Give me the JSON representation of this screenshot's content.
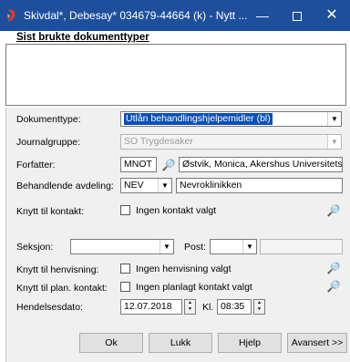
{
  "window": {
    "title": "Skivdal*, Debesay* 034679-44664 (k) - Nytt ...",
    "minimize": "—",
    "close": "✕"
  },
  "recent": {
    "label": "Sist brukte dokumenttyper"
  },
  "form": {
    "dokumenttype": {
      "label": "Dokumenttype:",
      "value": "Utlån behandlingshjelpemidler (bl)"
    },
    "journalgruppe": {
      "label": "Journalgruppe:",
      "value": "SO Trygdesaker"
    },
    "forfatter": {
      "label": "Forfatter:",
      "code": "MNOT",
      "name": "Østvik, Monica, Akershus Universitetssy"
    },
    "avdeling": {
      "label": "Behandlende avdeling:",
      "code": "NEV",
      "name": "Nevroklinikken"
    },
    "kontakt": {
      "label": "Knytt til kontakt:",
      "option": "Ingen kontakt valgt"
    },
    "seksjon": {
      "label": "Seksjon:",
      "value": ""
    },
    "post": {
      "label": "Post:",
      "value": ""
    },
    "henvisning": {
      "label": "Knytt til henvisning:",
      "option": "Ingen henvisning valgt"
    },
    "plan_kontakt": {
      "label": "Knytt til plan. kontakt:",
      "option": "Ingen planlagt kontakt valgt"
    },
    "hendelsesdato": {
      "label": "Hendelsesdato:",
      "date": "12.07.2018",
      "time_label": "Kl.",
      "time": "08:35"
    }
  },
  "buttons": {
    "ok": "Ok",
    "lukk": "Lukk",
    "hjelp": "Hjelp",
    "avansert": "Avansert >>"
  },
  "colors": {
    "titlebar": "#1e4f9c",
    "selection": "#0a4fb6"
  }
}
